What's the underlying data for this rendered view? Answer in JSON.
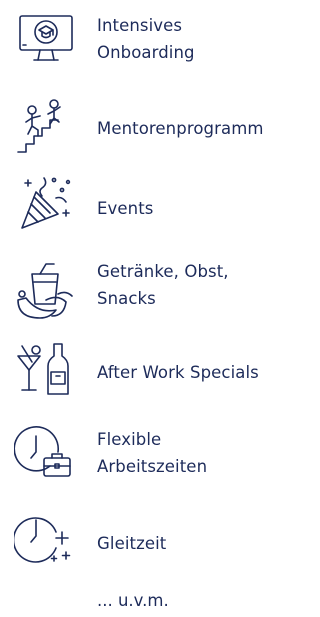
{
  "colors": {
    "text": "#1d2b5a",
    "icon_stroke": "#1d2b5a",
    "background": "#ffffff"
  },
  "benefits": [
    {
      "icon": "onboarding-monitor-icon",
      "lines": [
        "Intensives",
        "Onboarding"
      ]
    },
    {
      "icon": "mentoring-stairs-icon",
      "lines": [
        "Mentorenprogramm"
      ]
    },
    {
      "icon": "party-popper-icon",
      "lines": [
        "Events"
      ]
    },
    {
      "icon": "drinks-fruit-icon",
      "lines": [
        "Getränke, Obst,",
        "Snacks"
      ]
    },
    {
      "icon": "cocktail-bottle-icon",
      "lines": [
        "After Work Specials"
      ]
    },
    {
      "icon": "clock-briefcase-icon",
      "lines": [
        "Flexible",
        "Arbeitszeiten"
      ]
    },
    {
      "icon": "clock-plus-icon",
      "lines": [
        "Gleitzeit"
      ]
    }
  ],
  "more_text": "... u.v.m."
}
